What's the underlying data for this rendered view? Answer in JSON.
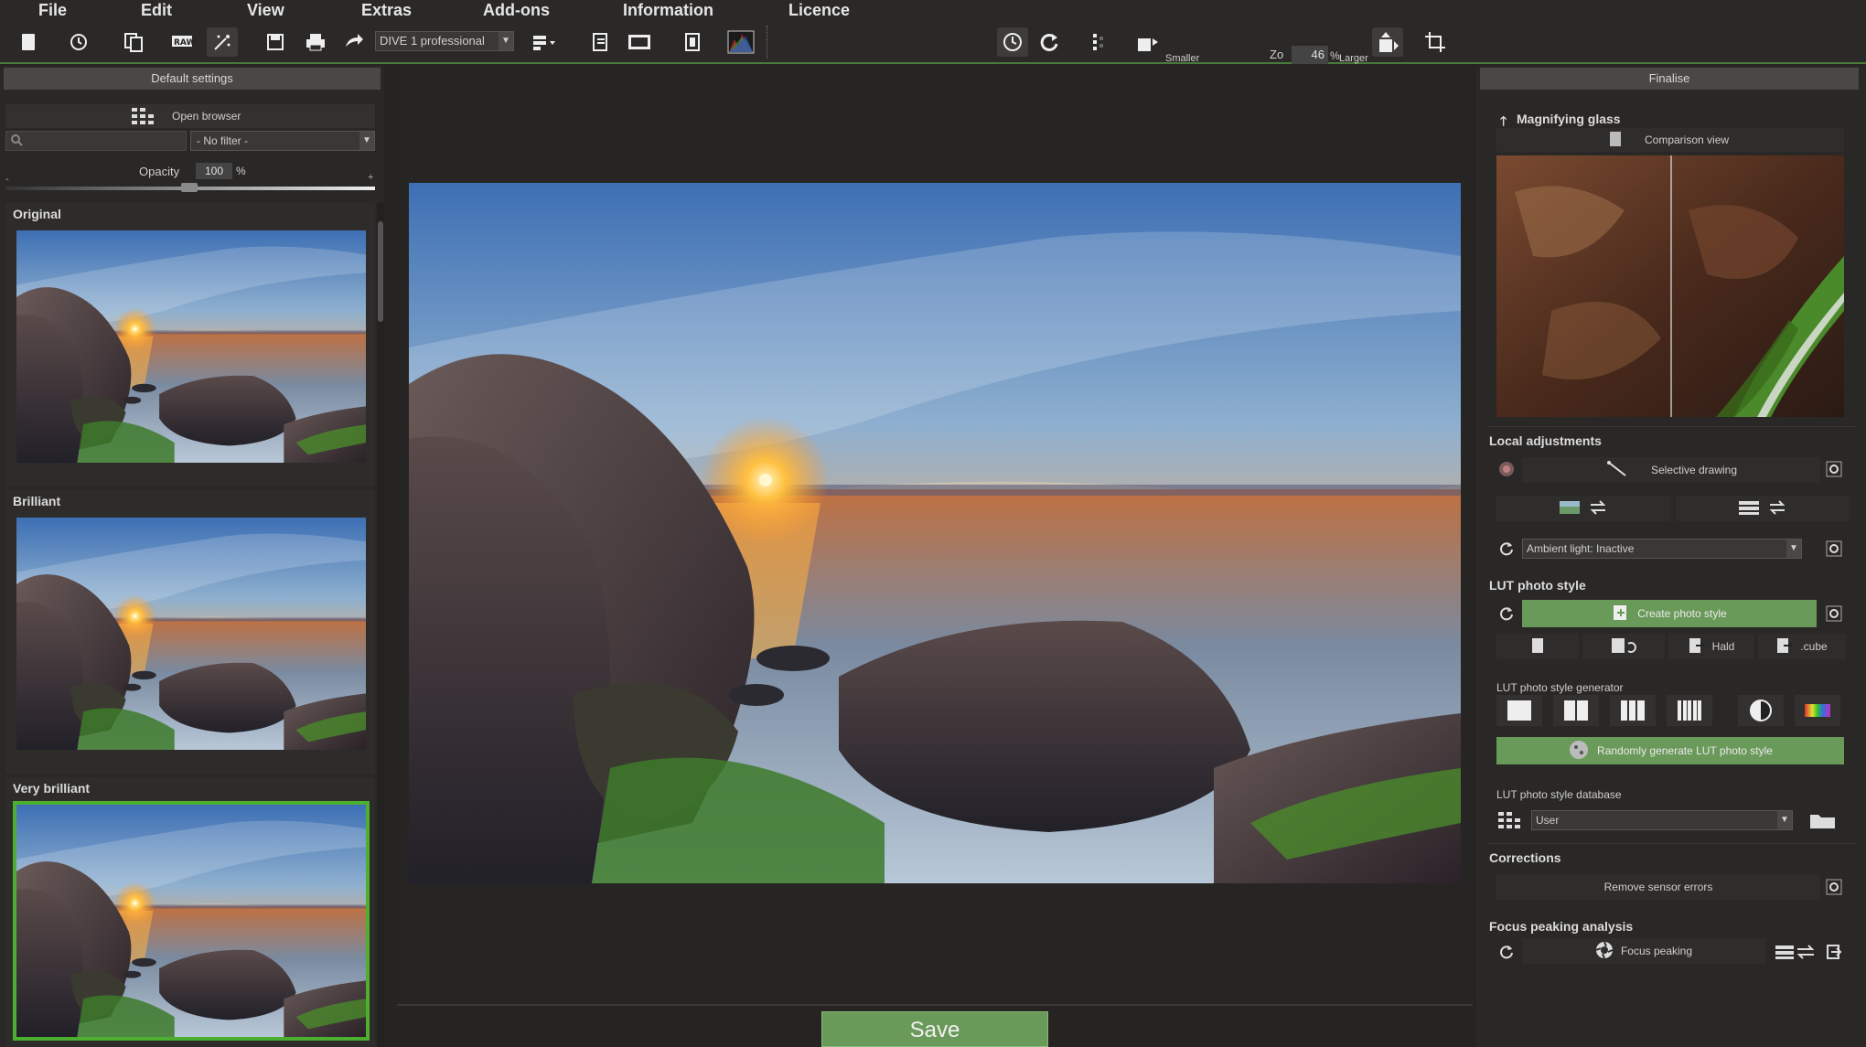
{
  "menu": {
    "file": "File",
    "edit": "Edit",
    "view": "View",
    "extras": "Extras",
    "addons": "Add-ons",
    "information": "Information",
    "licence": "Licence"
  },
  "toolbar": {
    "preset_value": "DIVE 1 professional",
    "zoom_smaller": "Smaller",
    "zoom_larger": "Larger",
    "zoom_label": "Zo",
    "zoom_value": "46",
    "zoom_unit": "%"
  },
  "left_panel": {
    "header": "Default settings",
    "open_browser": "Open browser",
    "filter_value": "- No filter -",
    "opacity_label": "Opacity",
    "opacity_value": "100",
    "opacity_unit": "%",
    "opacity_min": "-",
    "opacity_max": "+",
    "presets": [
      {
        "title": "Original"
      },
      {
        "title": "Brilliant"
      },
      {
        "title": "Very brilliant"
      }
    ]
  },
  "center": {
    "save_label": "Save"
  },
  "right_panel": {
    "header": "Finalise",
    "magnifying_glass": "Magnifying glass",
    "comparison_view": "Comparison view",
    "local_adjustments": "Local adjustments",
    "selective_drawing": "Selective drawing",
    "ambient_light": "Ambient light: Inactive",
    "lut_photo_style": "LUT photo style",
    "create_photo_style": "Create photo style",
    "hald": "Hald",
    "cube": ".cube",
    "lut_generator": "LUT photo style generator",
    "random_lut": "Randomly generate LUT photo style",
    "lut_database": "LUT photo style database",
    "database_value": "User",
    "corrections": "Corrections",
    "remove_sensor_errors": "Remove sensor errors",
    "focus_peaking_analysis": "Focus peaking analysis",
    "focus_peaking": "Focus peaking"
  }
}
